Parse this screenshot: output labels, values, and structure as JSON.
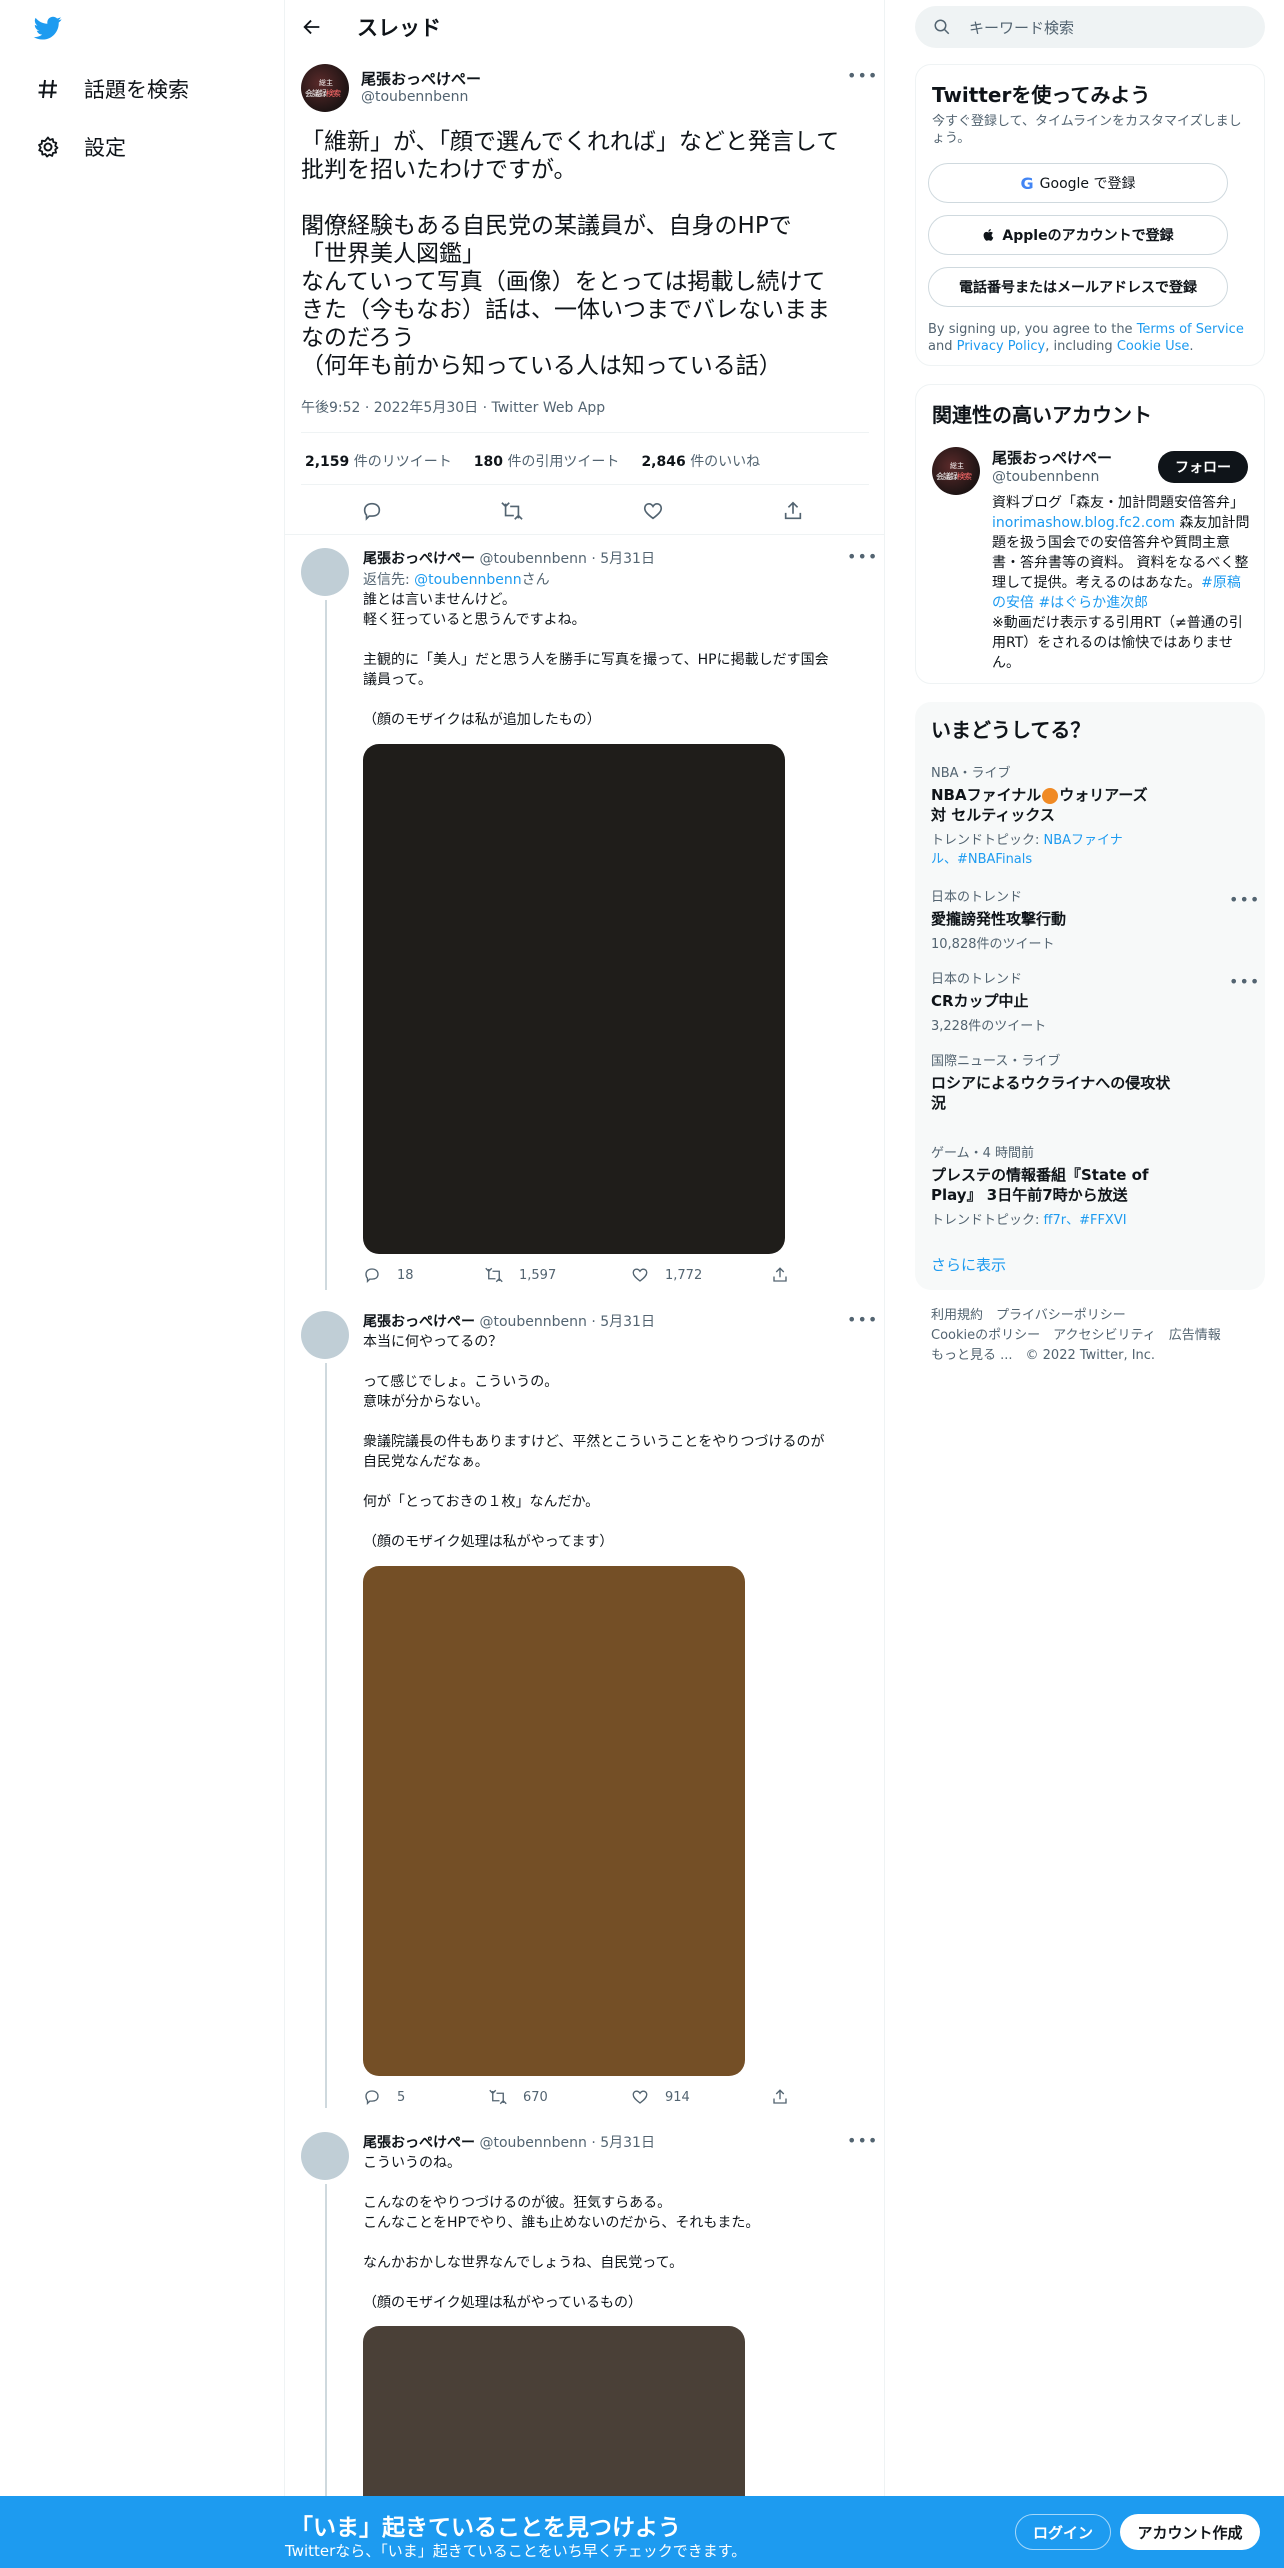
{
  "nav": {
    "items": [
      {
        "label": "話題を検索",
        "icon": "hashtag-icon"
      },
      {
        "label": "設定",
        "icon": "gear-icon"
      }
    ]
  },
  "header": {
    "title": "スレッド"
  },
  "main_tweet": {
    "avatar_text": {
      "line1": "総主",
      "line2a": "会議録",
      "line2b": "検索"
    },
    "name": "尾張おっぺけぺー",
    "handle": "@toubennbenn",
    "text": "「維新」が、「顔で選んでくれれば」などと発言して\n批判を招いたわけですが。\n\n閣僚経験もある自民党の某議員が、自身のHPで\n「世界美人図鑑」\nなんていって写真（画像）をとっては掲載し続けて\nきた（今もなお）話は、一体いつまでバレないまま\nなのだろう\n（何年も前から知っている人は知っている話）",
    "meta": "午後9:52 · 2022年5月30日 · Twitter Web App",
    "retweets": "2,159",
    "retweets_label": "件のリツイート",
    "quotes": "180",
    "quotes_label": "件の引用ツイート",
    "likes": "2,846",
    "likes_label": "件のいいね"
  },
  "replies": [
    {
      "name": "尾張おっぺけぺー",
      "handle": "@toubennbenn",
      "date": "5月31日",
      "reply_to_prefix": "返信先: ",
      "reply_to": "@toubennbenn",
      "reply_to_suffix": "さん",
      "text": "誰とは言いませんけど。\n軽く狂っていると思うんですよね。\n\n主観的に「美人」だと思う人を勝手に写真を撮って、HPに掲載しだす国会\n議員って。\n\n（顔のモザイクは私が追加したもの）",
      "media_color": "#1f1d1a",
      "reply_count": "18",
      "retweet_count": "1,597",
      "like_count": "1,772"
    },
    {
      "name": "尾張おっぺけぺー",
      "handle": "@toubennbenn",
      "date": "5月31日",
      "text": "本当に何やってるの？\n\nって感じでしょ。こういうの。\n意味が分からない。\n\n衆議院議長の件もありますけど、平然とこういうことをやりつづけるのが\n自民党なんだなぁ。\n\n何が「とっておきの１枚」なんだか。\n\n（顔のモザイク処理は私がやってます）",
      "media_color": "#744f26",
      "reply_count": "5",
      "retweet_count": "670",
      "like_count": "914"
    },
    {
      "name": "尾張おっぺけぺー",
      "handle": "@toubennbenn",
      "date": "5月31日",
      "text": "こういうのね。\n\nこんなのをやりつづけるのが彼。狂気すらある。\nこんなことをHPでやり、誰も止めないのだから、それもまた。\n\nなんかおかしな世界なんでしょうね、自民党って。\n\n（顔のモザイク処理は私がやっているもの）",
      "media_color": "#4a4037"
    }
  ],
  "search": {
    "placeholder": "キーワード検索"
  },
  "signup": {
    "title": "Twitterを使ってみよう",
    "subtitle": "今すぐ登録して、タイムラインをカスタマイズしましょう。",
    "google": "Google で登録",
    "apple": "Appleのアカウントで登録",
    "phone": "電話番号またはメールアドレスで登録",
    "terms_prefix": "By signing up, you agree to the ",
    "terms_link": "Terms of Service",
    "terms_mid": " and ",
    "privacy_link": "Privacy Policy",
    "terms_mid2": ", including ",
    "cookie_link": "Cookie Use",
    "terms_end": "."
  },
  "related": {
    "title": "関連性の高いアカウント",
    "name": "尾張おっぺけぺー",
    "handle": "@toubennbenn",
    "follow": "フォロー",
    "bio_1": "資料ブログ「森友・加計問題安倍答弁」",
    "bio_link": "inorimashow.blog.fc2.com",
    "bio_2": " 森友加計問題を扱う国会での安倍答弁や質問主意書・答弁書等の資料。 資料をなるべく整理して提供。考えるのはあなた。",
    "bio_tag1": "#原稿の安倍",
    "bio_tag2": "#はぐらか進次郎",
    "bio_3": "※動画だけ表示する引用RT（≠普通の引用RT）をされるのは愉快ではありません。"
  },
  "trends": {
    "title": "いまどうしてる？",
    "items": [
      {
        "category": "NBA・ライブ",
        "title_a": "NBAファイナル",
        "title_b": "ウォリアーズ 対 セルティックス",
        "sub_prefix": "トレンドトピック: ",
        "sub_links": "NBAファイナル、#NBAFinals"
      },
      {
        "category": "日本のトレンド",
        "title": "愛攏謗発性攻撃行動",
        "count": "10,828件のツイート"
      },
      {
        "category": "日本のトレンド",
        "title": "CRカップ中止",
        "count": "3,228件のツイート"
      },
      {
        "category": "国際ニュース・ライブ",
        "title": "ロシアによるウクライナへの侵攻状況"
      },
      {
        "category": "ゲーム・4 時間前",
        "title": "プレステの情報番組『State of Play』 3日午前7時から放送",
        "sub_prefix": "トレンドトピック: ",
        "sub_links": "ff7r、#FFXVI"
      }
    ],
    "show_more": "さらに表示"
  },
  "footer": {
    "line1": "利用規約　プライバシーポリシー",
    "line2": "Cookieのポリシー　アクセシビリティ　広告情報",
    "line3": "もっと見る ...　© 2022 Twitter, Inc."
  },
  "bottom": {
    "headline": "「いま」起きていることを見つけよう",
    "sub": "Twitterなら、「いま」起きていることをいち早くチェックできます。",
    "login": "ログイン",
    "signup": "アカウント作成"
  },
  "colors": {
    "accent": "#1d9bf0",
    "bottom_bg": "#1d9bf0",
    "follow_bg": "#0f1419"
  }
}
